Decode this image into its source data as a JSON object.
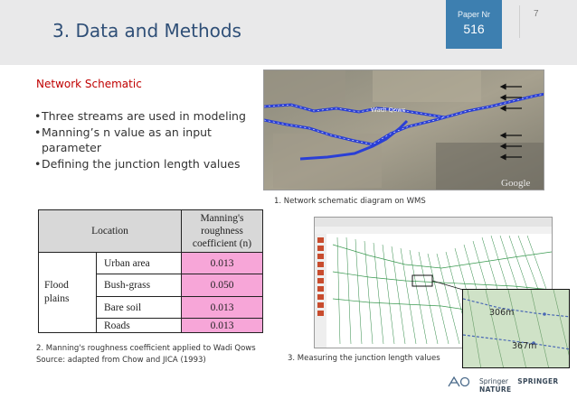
{
  "header": {
    "title": "3. Data and Methods",
    "paper_label": "Paper Nr",
    "paper_number": "516",
    "slide_number": "7"
  },
  "section": {
    "heading": "Network Schematic",
    "bullets": [
      "Three streams are used in modeling",
      "Manning’s n value as an input parameter",
      "Defining the junction length values"
    ]
  },
  "map": {
    "caption": "1. Network schematic diagram on WMS",
    "labels": [
      "Wadi Qows",
      "Google"
    ]
  },
  "table": {
    "headers": [
      "Location",
      "Manning's roughness coefficient (n)"
    ],
    "group_label": "Flood plains",
    "rows": [
      {
        "type": "Urban area",
        "n": "0.013"
      },
      {
        "type": "Bush-grass",
        "n": "0.050"
      },
      {
        "type": "Bare soil",
        "n": "0.013"
      },
      {
        "type": "Roads",
        "n": "0.013"
      }
    ],
    "caption": "2. Manning's roughness coefficient applied to Wadi Qows Source: adapted from Chow and JICA (1993)"
  },
  "gis": {
    "caption": "3. Measuring the junction length values",
    "inset_label_1": "306m",
    "inset_label_2": "367m"
  },
  "footer": {
    "logo_1": "Springer",
    "logo_2": "SPRINGER NATURE"
  },
  "colors": {
    "title": "#2f4f77",
    "paper_box": "#3d7fb0",
    "heading": "#c00000",
    "table_value_fill": "#f7a6d8",
    "table_header_fill": "#d8d8d8"
  }
}
